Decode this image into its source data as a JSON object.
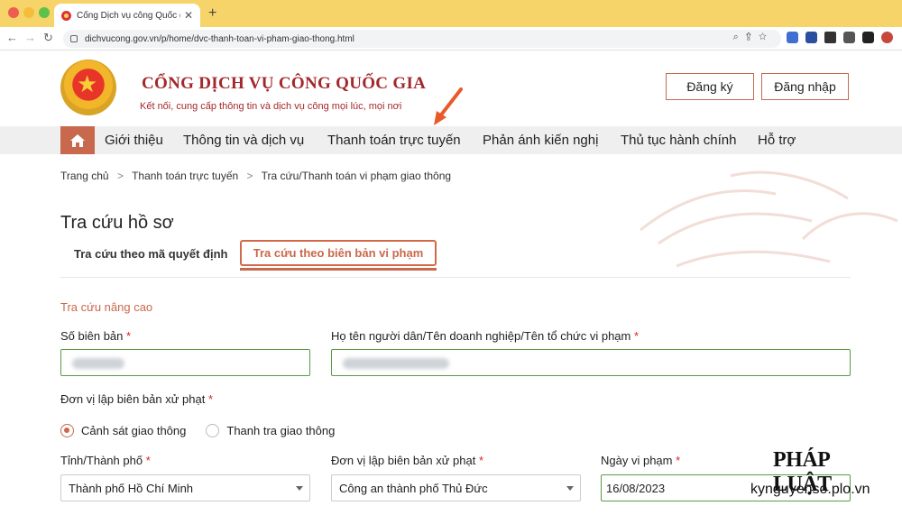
{
  "browser": {
    "tab_title": "Cổng Dịch vụ công Quốc gia",
    "url": "dichvucong.gov.vn/p/home/dvc-thanh-toan-vi-pham-giao-thong.html"
  },
  "header": {
    "brand_name": "CỔNG DỊCH VỤ CÔNG QUỐC GIA",
    "tagline": "Kết nối, cung cấp thông tin và dịch vụ công mọi lúc, mọi nơi",
    "register_label": "Đăng ký",
    "login_label": "Đăng nhập"
  },
  "nav": {
    "items": [
      {
        "label": "Giới thiệu"
      },
      {
        "label": "Thông tin và dịch vụ"
      },
      {
        "label": "Thanh toán trực tuyến"
      },
      {
        "label": "Phản ánh kiến nghị"
      },
      {
        "label": "Thủ tục hành chính"
      },
      {
        "label": "Hỗ trợ"
      }
    ]
  },
  "breadcrumb": [
    "Trang chủ",
    "Thanh toán trực tuyến",
    "Tra cứu/Thanh toán vi phạm giao thông"
  ],
  "main": {
    "title": "Tra cứu hồ sơ",
    "tabs": [
      {
        "label": "Tra cứu theo mã quyết định",
        "active": false
      },
      {
        "label": "Tra cứu theo biên bản vi phạm",
        "active": true
      }
    ],
    "section_title": "Tra cứu nâng cao",
    "fields": {
      "record_no_label": "Số biên bản",
      "name_label": "Họ tên người dân/Tên doanh nghiệp/Tên tổ chức vi phạm",
      "issuer_label": "Đơn vị lập biên bản xử phạt",
      "province_label": "Tỉnh/Thành phố",
      "unit_label": "Đơn vị lập biên bản xử phạt",
      "date_label": "Ngày vi phạm",
      "required_mark": "*"
    },
    "radios": [
      {
        "label": "Cảnh sát giao thông",
        "checked": true
      },
      {
        "label": "Thanh tra giao thông",
        "checked": false
      }
    ],
    "selects": {
      "province_value": "Thành phố Hồ Chí Minh",
      "unit_value": "Công an thành phố Thủ Đức"
    },
    "date_value": "16/08/2023"
  },
  "watermark": {
    "logo": "PHÁP LUẬT",
    "url": "kynguyenso.plo.vn"
  },
  "colors": {
    "accent": "#c8684c",
    "brand_red": "#a3282b",
    "tab_bar": "#f6d46a",
    "field_border": "#5a9a47"
  }
}
